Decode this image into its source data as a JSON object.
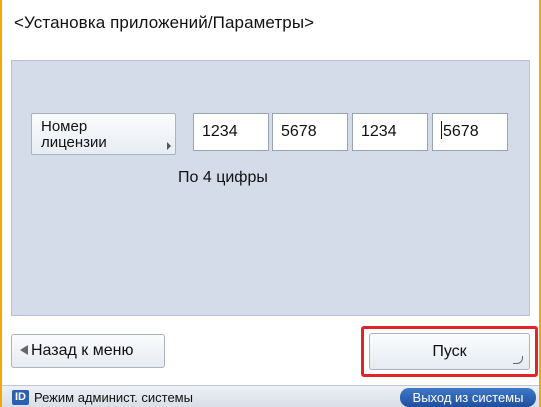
{
  "header": {
    "title": "<Установка приложений/Параметры>"
  },
  "license": {
    "label_line1": "Номер",
    "label_line2": "лицензии",
    "fields": [
      "1234",
      "5678",
      "1234",
      "5678"
    ],
    "hint": "По 4 цифры"
  },
  "footer": {
    "back_label": "Назад к меню",
    "start_label": "Пуск"
  },
  "status_bar": {
    "badge": "ID",
    "mode_text": "Режим админист. системы",
    "logout_label": "Выход из системы"
  }
}
